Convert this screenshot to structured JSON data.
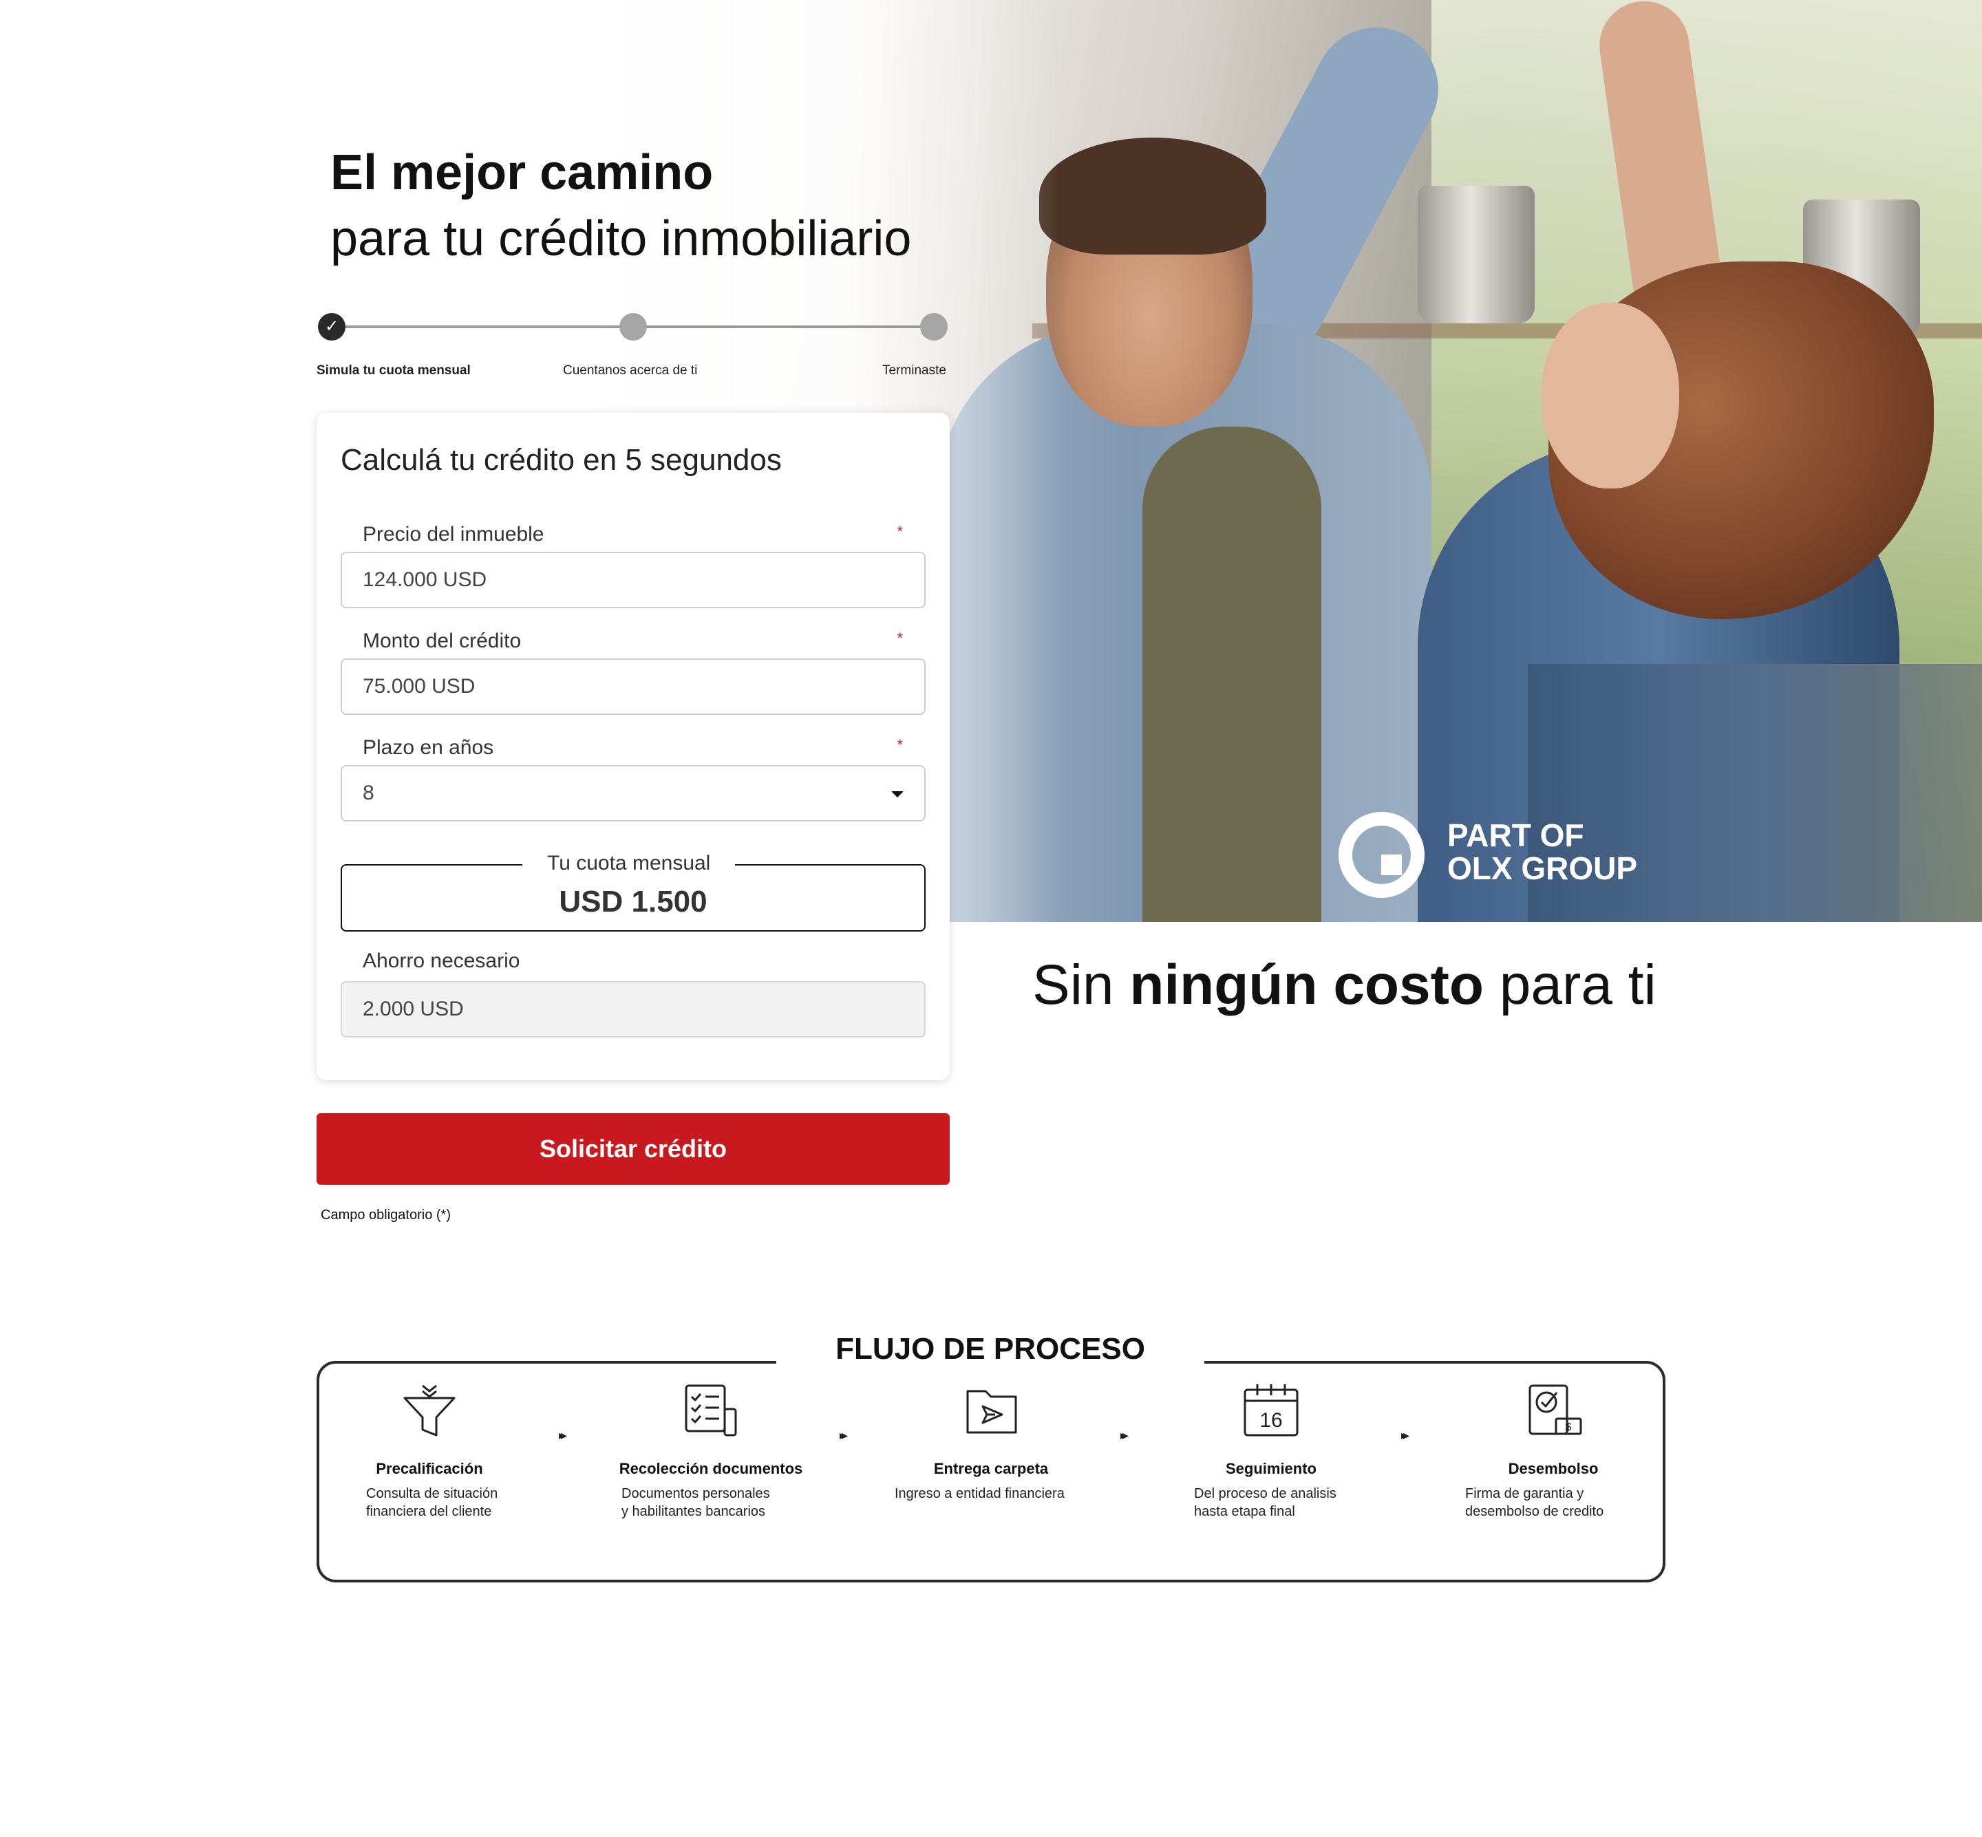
{
  "hero": {
    "headline_bold": "El mejor camino",
    "headline_regular": "para tu crédito inmobiliario",
    "badge_line1": "PART OF",
    "badge_line2": "OLX GROUP"
  },
  "stepper": {
    "steps": [
      {
        "label": "Simula tu cuota mensual",
        "state": "done"
      },
      {
        "label": "Cuentanos acerca de ti",
        "state": "pending"
      },
      {
        "label": "Terminaste",
        "state": "pending"
      }
    ]
  },
  "calculator": {
    "title": "Calculá tu crédito en 5 segundos",
    "required_mark": "*",
    "price": {
      "label": "Precio del inmueble",
      "value": "124.000 USD"
    },
    "loan": {
      "label": "Monto del crédito",
      "value": "75.000 USD"
    },
    "term": {
      "label": "Plazo en años",
      "value": "8"
    },
    "quota": {
      "label": "Tu cuota mensual",
      "value": "USD 1.500"
    },
    "savings": {
      "label": "Ahorro necesario",
      "value": "2.000 USD"
    }
  },
  "cta": {
    "label": "Solicitar crédito"
  },
  "required_note": "Campo obligatorio (*)",
  "tagline": {
    "pre": "Sin ",
    "bold": "ningún costo",
    "post": " para ti"
  },
  "flow": {
    "title": "FLUJO DE PROCESO",
    "arrow": "▸▸",
    "steps": [
      {
        "name": "Precalificación",
        "desc1": "Consulta de situación",
        "desc2": "financiera del cliente",
        "icon": "funnel-icon"
      },
      {
        "name": "Recolección documentos",
        "desc1": "Documentos personales",
        "desc2": "y habilitantes bancarios",
        "icon": "checklist-icon"
      },
      {
        "name": "Entrega carpeta",
        "desc1": "Ingreso a entidad financiera",
        "desc2": "",
        "icon": "folder-send-icon"
      },
      {
        "name": "Seguimiento",
        "desc1": "Del proceso de analisis",
        "desc2": "hasta etapa final",
        "icon": "calendar-icon",
        "calendar_day": "16"
      },
      {
        "name": "Desembolso",
        "desc1": "Firma de garantia y",
        "desc2": "desembolso de credito",
        "icon": "document-money-icon"
      }
    ]
  },
  "colors": {
    "accent": "#c8191f",
    "text": "#111111",
    "required": "#d32027"
  }
}
